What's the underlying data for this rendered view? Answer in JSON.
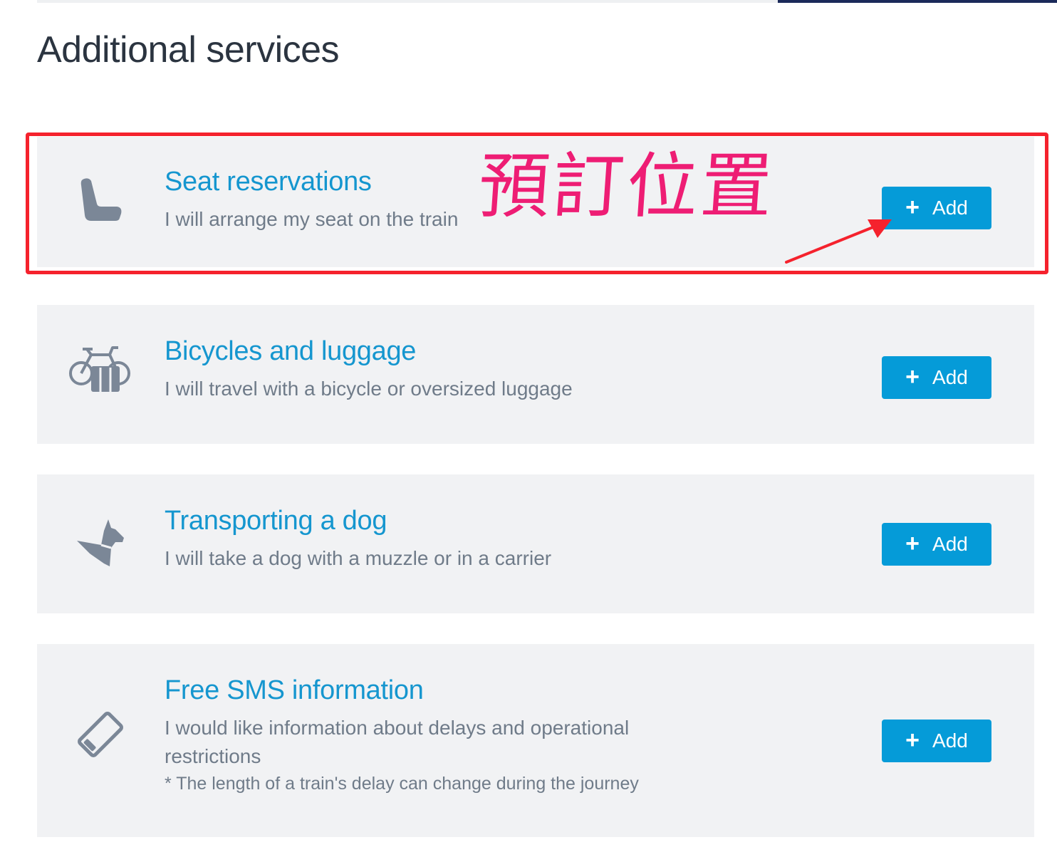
{
  "page": {
    "title": "Additional services"
  },
  "annotation": {
    "text": "預訂位置",
    "color": "#ee1d74",
    "highlight_color": "#f5222d"
  },
  "services": [
    {
      "icon": "seat-icon",
      "title": "Seat reservations",
      "description": "I will arrange my seat on the train",
      "button": {
        "icon": "plus-icon",
        "label": "Add"
      }
    },
    {
      "icon": "bicycle-luggage-icon",
      "title": "Bicycles and luggage",
      "description": "I will travel with a bicycle or oversized luggage",
      "button": {
        "icon": "plus-icon",
        "label": "Add"
      }
    },
    {
      "icon": "dog-icon",
      "title": "Transporting a dog",
      "description": "I will take a dog with a muzzle or in a carrier",
      "button": {
        "icon": "plus-icon",
        "label": "Add"
      }
    },
    {
      "icon": "phone-icon",
      "title": "Free SMS information",
      "description": "I would like information about delays and operational restrictions",
      "note": "* The length of a train's delay can change during the journey",
      "button": {
        "icon": "plus-icon",
        "label": "Add"
      }
    }
  ],
  "colors": {
    "accent": "#059bd8",
    "title_blue": "#1596cf",
    "card_bg": "#f1f2f4",
    "text_grey": "#6f7b89",
    "icon_grey": "#7b8797"
  }
}
